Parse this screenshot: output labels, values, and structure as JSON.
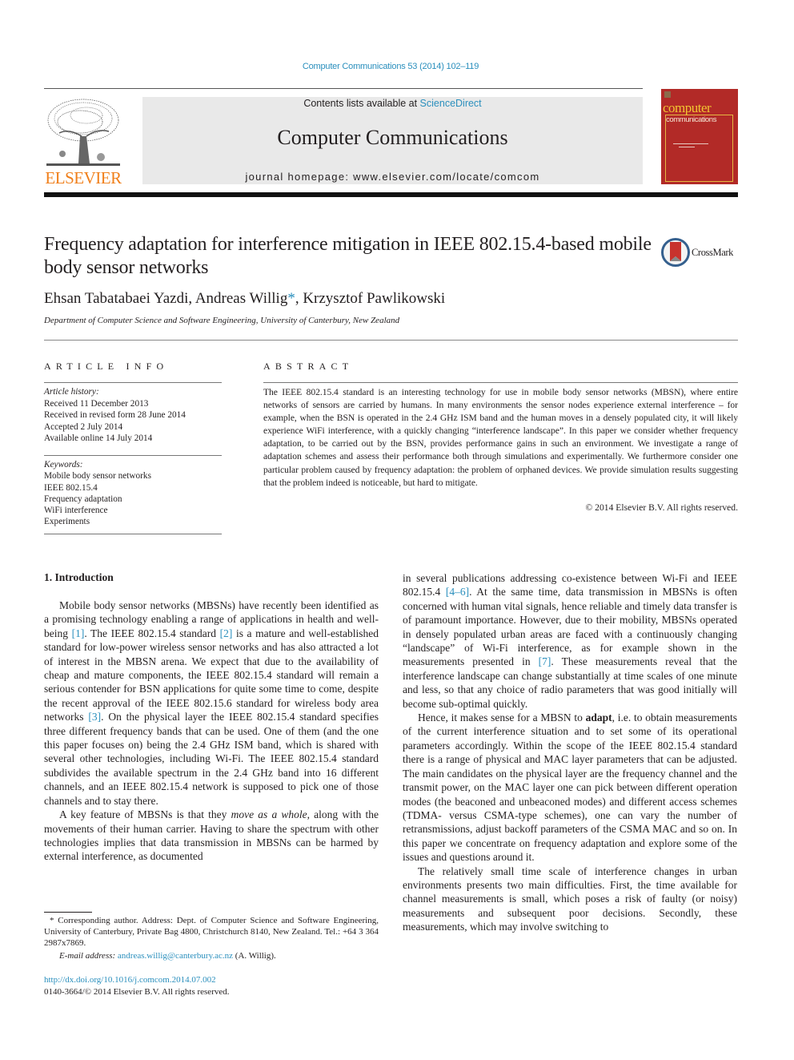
{
  "header": {
    "journal_ref": "Computer Communications 53 (2014) 102–119",
    "contents_prefix": "Contents lists available at ",
    "contents_link": "ScienceDirect",
    "journal_title": "Computer Communications",
    "homepage_prefix": "journal homepage: ",
    "homepage_url": "www.elsevier.com/locate/comcom",
    "publisher_logo": "ELSEVIER",
    "publisher_logo_icon": "elsevier-tree-icon",
    "cover": {
      "title_line1": "computer",
      "title_line2": "communications"
    },
    "colors": {
      "link": "#2a8fbd",
      "elsevier_orange": "#f07f1a",
      "cover_red": "#b22a27",
      "cover_yellow": "#f2c531"
    }
  },
  "article": {
    "title": "Frequency adaptation for interference mitigation in IEEE 802.15.4-based mobile body sensor networks",
    "crossmark_label": "CrossMark",
    "authors": [
      {
        "name": "Ehsan Tabatabaei Yazdi",
        "mark": ""
      },
      {
        "name": "Andreas Willig",
        "mark": "*"
      },
      {
        "name": "Krzysztof Pawlikowski",
        "mark": ""
      }
    ],
    "affiliation": "Department of Computer Science and Software Engineering, University of Canterbury, New Zealand"
  },
  "article_info": {
    "heading": "ARTICLE INFO",
    "history_label": "Article history:",
    "history": [
      "Received 11 December 2013",
      "Received in revised form 28 June 2014",
      "Accepted 2 July 2014",
      "Available online 14 July 2014"
    ],
    "keywords_label": "Keywords:",
    "keywords": [
      "Mobile body sensor networks",
      "IEEE 802.15.4",
      "Frequency adaptation",
      "WiFi interference",
      "Experiments"
    ]
  },
  "abstract": {
    "heading": "ABSTRACT",
    "text": "The IEEE 802.15.4 standard is an interesting technology for use in mobile body sensor networks (MBSN), where entire networks of sensors are carried by humans. In many environments the sensor nodes experience external interference – for example, when the BSN is operated in the 2.4 GHz ISM band and the human moves in a densely populated city, it will likely experience WiFi interference, with a quickly changing “interference landscape”. In this paper we consider whether frequency adaptation, to be carried out by the BSN, provides performance gains in such an environment. We investigate a range of adaptation schemes and assess their performance both through simulations and experimentally. We furthermore consider one particular problem caused by frequency adaptation: the problem of orphaned devices. We provide simulation results suggesting that the problem indeed is noticeable, but hard to mitigate.",
    "copyright": "© 2014 Elsevier B.V. All rights reserved."
  },
  "body": {
    "section_heading": "1. Introduction",
    "p1": {
      "t1": "Mobile body sensor networks (MBSNs) have recently been identified as a promising technology enabling a range of applications in health and well-being ",
      "r1": "[1]",
      "t2": ". The IEEE 802.15.4 standard ",
      "r2": "[2]",
      "t3": " is a mature and well-established standard for low-power wireless sensor networks and has also attracted a lot of interest in the MBSN arena. We expect that due to the availability of cheap and mature components, the IEEE 802.15.4 standard will remain a serious contender for BSN applications for quite some time to come, despite the recent approval of the IEEE 802.15.6 standard for wireless body area networks ",
      "r3": "[3]",
      "t4": ". On the physical layer the IEEE 802.15.4 standard specifies three different frequency bands that can be used. One of them (and the one this paper focuses on) being the 2.4 GHz ISM band, which is shared with several other technologies, including Wi-Fi. The IEEE 802.15.4 standard subdivides the available spectrum in the 2.4 GHz band into 16 different channels, and an IEEE 802.15.4 network is supposed to pick one of those channels and to stay there."
    },
    "p2": {
      "t1": "A key feature of MBSNs is that they ",
      "em": "move as a whole",
      "t2": ", along with the movements of their human carrier. Having to share the spectrum with other technologies implies that data transmission in MBSNs can be harmed by external interference, as documented"
    },
    "p2_cont": {
      "t1": "in several publications addressing co-existence between Wi-Fi and IEEE 802.15.4 ",
      "r1": "[4–6]",
      "t2": ". At the same time, data transmission in MBSNs is often concerned with human vital signals, hence reliable and timely data transfer is of paramount importance. However, due to their mobility, MBSNs operated in densely populated urban areas are faced with a continuously changing “landscape” of Wi-Fi interference, as for example shown in the measurements presented in ",
      "r2": "[7]",
      "t3": ". These measurements reveal that the interference landscape can change substantially at time scales of one minute and less, so that any choice of radio parameters that was good initially will become sub-optimal quickly."
    },
    "p3": {
      "t1": "Hence, it makes sense for a MBSN to ",
      "strong": "adapt",
      "t2": ", i.e. to obtain measurements of the current interference situation and to set some of its operational parameters accordingly. Within the scope of the IEEE 802.15.4 standard there is a range of physical and MAC layer parameters that can be adjusted. The main candidates on the physical layer are the frequency channel and the transmit power, on the MAC layer one can pick between different operation modes (the beaconed and unbeaconed modes) and different access schemes (TDMA- versus CSMA-type schemes), one can vary the number of retransmissions, adjust backoff parameters of the CSMA MAC and so on. In this paper we concentrate on frequency adaptation and explore some of the issues and questions around it."
    },
    "p4": {
      "t1": "The relatively small time scale of interference changes in urban environments presents two main difficulties. First, the time available for channel measurements is small, which poses a risk of faulty (or noisy) measurements and subsequent poor decisions. Secondly, these measurements, which may involve switching to"
    }
  },
  "footnote": {
    "mark": "*",
    "text": " Corresponding author. Address: Dept. of Computer Science and Software Engineering, University of Canterbury, Private Bag 4800, Christchurch 8140, New Zealand. Tel.: +64 3 364 2987x7869.",
    "email_label": "E-mail address:",
    "email": "andreas.willig@canterbury.ac.nz",
    "email_suffix": " (A. Willig)."
  },
  "doi": {
    "url": "http://dx.doi.org/10.1016/j.comcom.2014.07.002",
    "issn_line": "0140-3664/© 2014 Elsevier B.V. All rights reserved."
  }
}
